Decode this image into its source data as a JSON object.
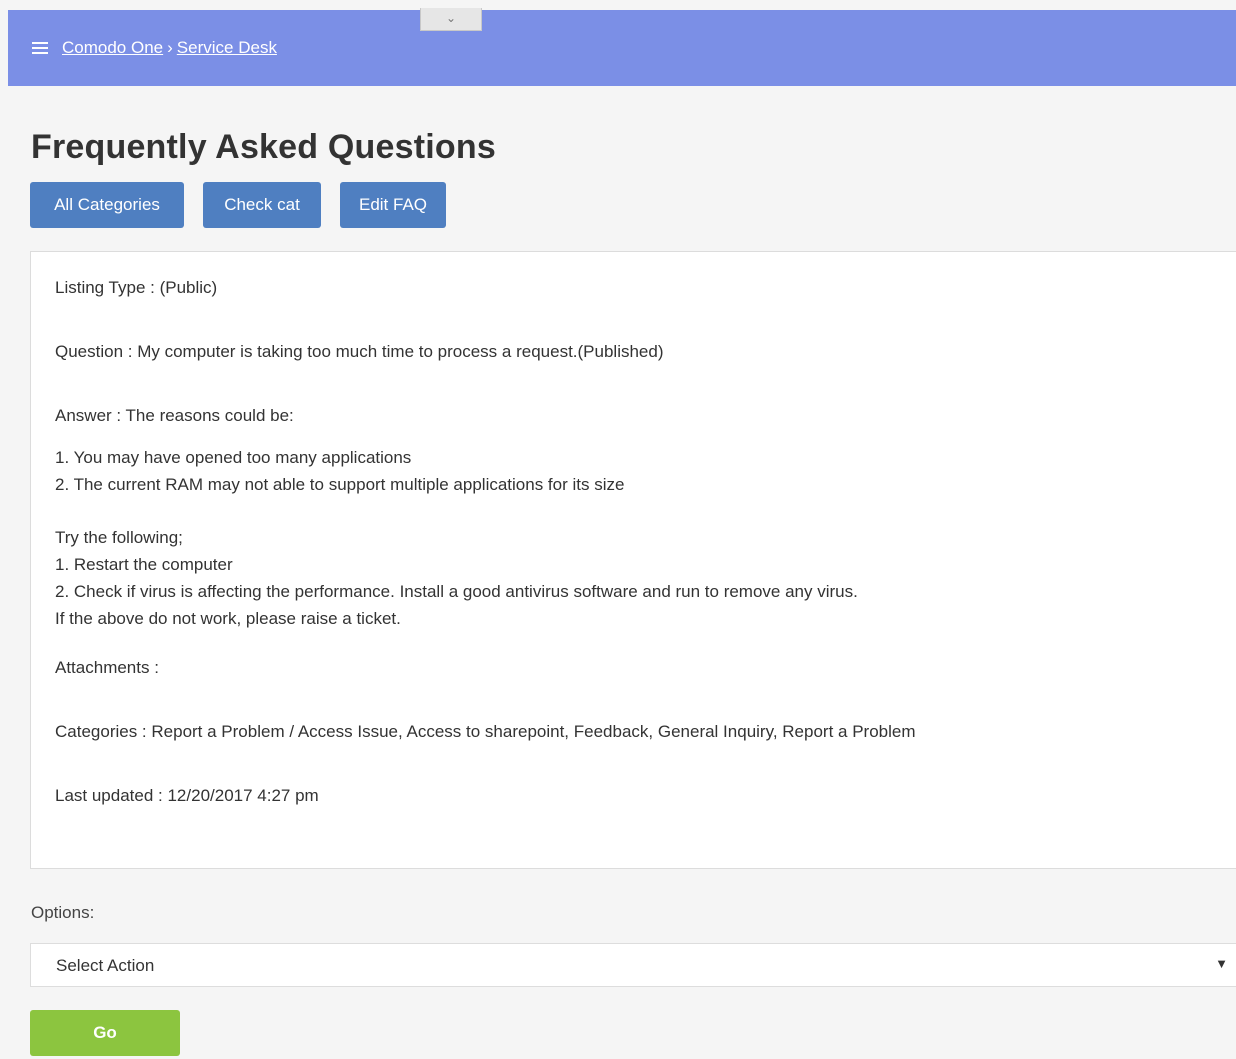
{
  "header": {
    "breadcrumb": [
      "Comodo One",
      "Service Desk"
    ],
    "breadcrumb_separator": "›",
    "collapse_glyph": "⌄"
  },
  "page": {
    "title": "Frequently Asked Questions",
    "buttons": [
      "All Categories",
      "Check cat",
      "Edit FAQ"
    ]
  },
  "faq": {
    "listing_type": "Listing Type : (Public)",
    "question": "Question : My computer is taking too much time to process a request.(Published)",
    "answer_intro": "Answer : The reasons could be:",
    "reasons": [
      "1. You may have opened too many applications",
      "2. The current RAM may not able to support multiple applications for its size"
    ],
    "steps": [
      "Try the following;",
      "1. Restart the computer",
      "2. Check if virus is affecting the performance. Install a good antivirus software and run to remove any virus.",
      "If the above do not work, please raise a ticket."
    ],
    "attachments": "Attachments :",
    "categories": "Categories : Report a Problem / Access Issue, Access to sharepoint, Feedback, General Inquiry, Report a Problem",
    "last_updated": "Last updated : 12/20/2017 4:27 pm"
  },
  "options": {
    "label": "Options:",
    "select_value": "Select Action",
    "caret": "▼",
    "go_label": "Go"
  },
  "colors": {
    "header_bg": "#7b8fe6",
    "primary_button": "#4f7fc1",
    "go_button": "#8cc53f"
  }
}
